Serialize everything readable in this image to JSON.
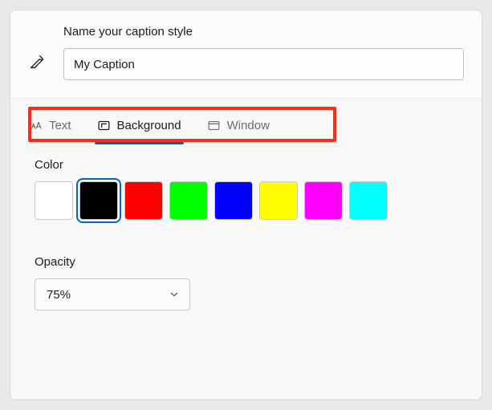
{
  "header": {
    "label": "Name your caption style",
    "input_value": "My Caption"
  },
  "tabs": {
    "text": {
      "label": "Text",
      "active": false
    },
    "background": {
      "label": "Background",
      "active": true
    },
    "window": {
      "label": "Window",
      "active": false
    }
  },
  "sections": {
    "color": {
      "label": "Color",
      "swatches": [
        {
          "hex": "#ffffff",
          "selected": false
        },
        {
          "hex": "#000000",
          "selected": true
        },
        {
          "hex": "#ff0000",
          "selected": false
        },
        {
          "hex": "#00ff00",
          "selected": false
        },
        {
          "hex": "#0000ff",
          "selected": false
        },
        {
          "hex": "#ffff00",
          "selected": false
        },
        {
          "hex": "#ff00ff",
          "selected": false
        },
        {
          "hex": "#00ffff",
          "selected": false
        }
      ]
    },
    "opacity": {
      "label": "Opacity",
      "value": "75%"
    }
  },
  "annotation": {
    "highlight_tabs": true
  }
}
